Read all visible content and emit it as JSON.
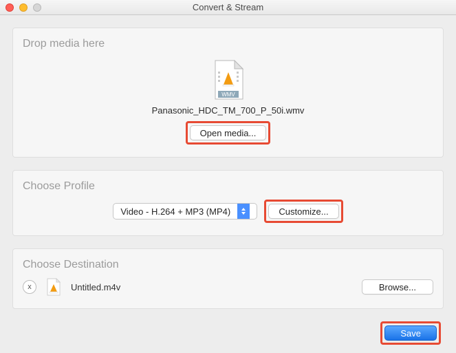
{
  "window": {
    "title": "Convert & Stream"
  },
  "drop": {
    "heading": "Drop media here",
    "file_type_badge": "WMV",
    "filename": "Panasonic_HDC_TM_700_P_50i.wmv",
    "open_label": "Open media..."
  },
  "profile": {
    "heading": "Choose Profile",
    "selected": "Video - H.264 + MP3 (MP4)",
    "customize_label": "Customize..."
  },
  "destination": {
    "heading": "Choose Destination",
    "remove_glyph": "x",
    "filename": "Untitled.m4v",
    "browse_label": "Browse..."
  },
  "footer": {
    "save_label": "Save"
  }
}
